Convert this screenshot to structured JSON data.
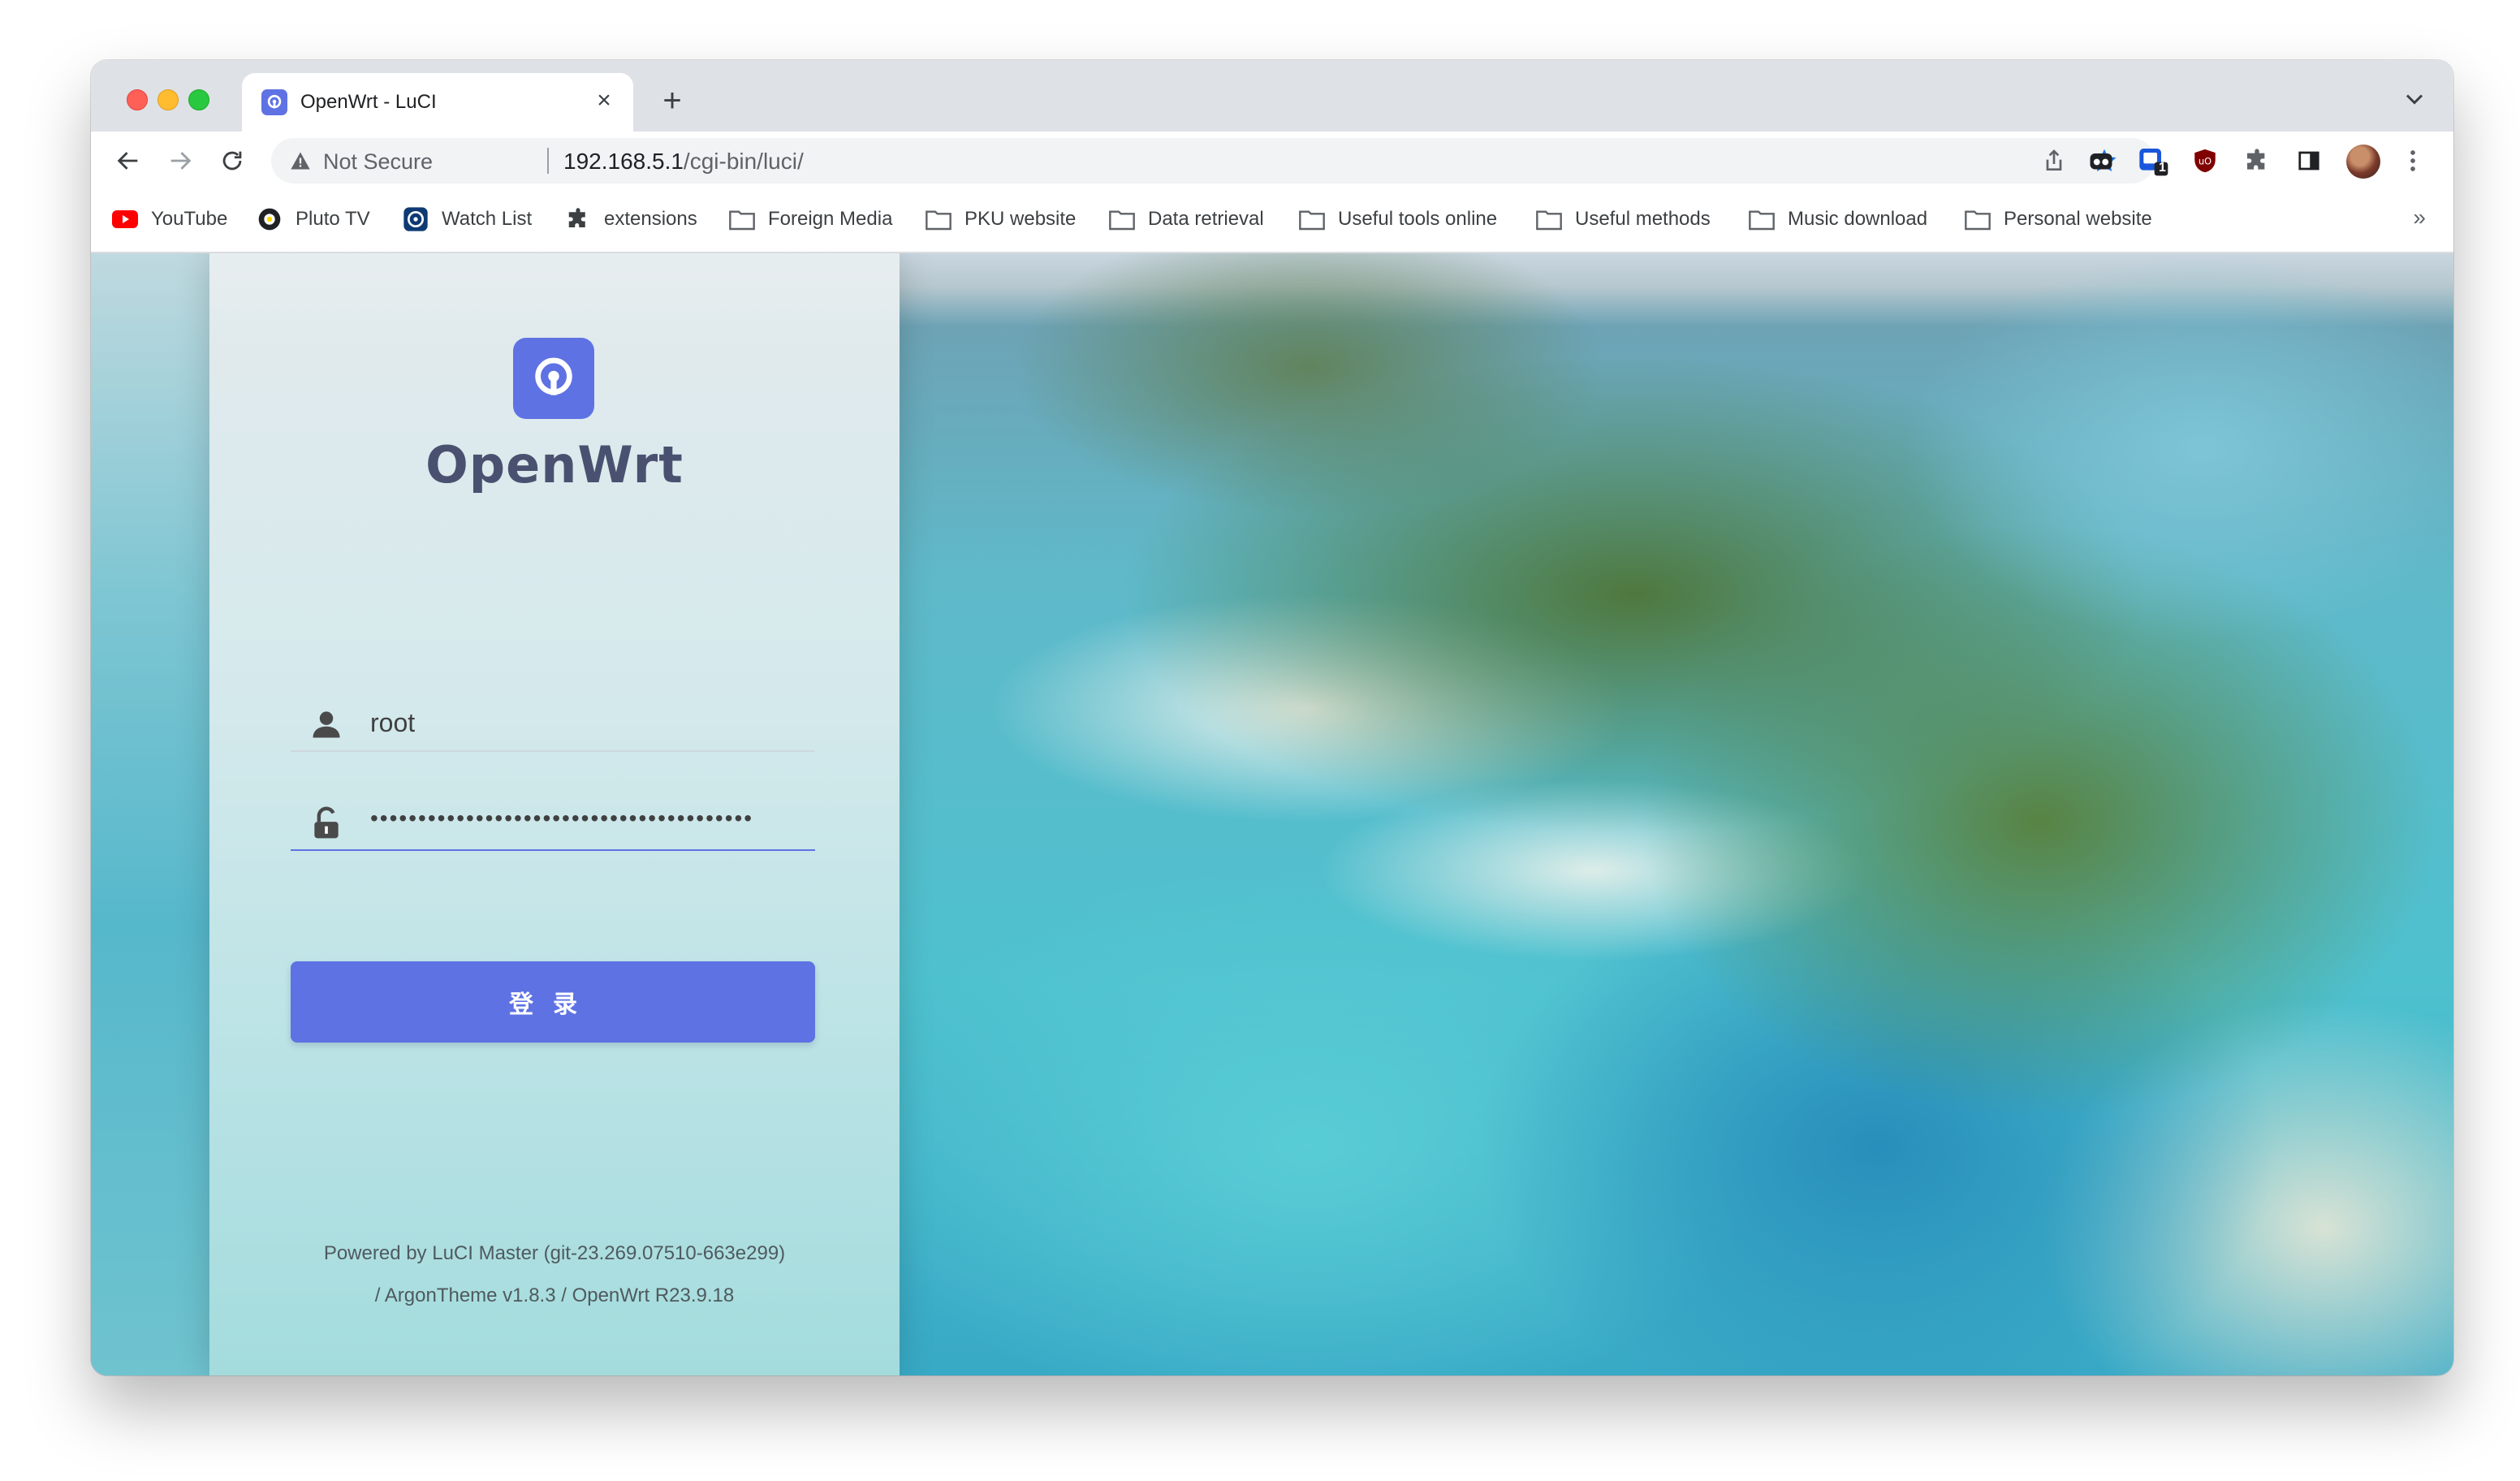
{
  "browser": {
    "tab_title": "OpenWrt - LuCI",
    "tab_close": "×",
    "new_tab": "+",
    "security_label": "Not Secure",
    "url_host": "192.168.5.1",
    "url_path": "/cgi-bin/luci/",
    "extension_badge": "1",
    "bookmarks": [
      {
        "label": "YouTube",
        "icon": "youtube-icon"
      },
      {
        "label": "Pluto TV",
        "icon": "pluto-tv-icon"
      },
      {
        "label": "Watch List",
        "icon": "watch-list-icon"
      },
      {
        "label": "extensions",
        "icon": "puzzle-icon"
      },
      {
        "label": "Foreign Media",
        "icon": "folder-icon"
      },
      {
        "label": "PKU website",
        "icon": "folder-icon"
      },
      {
        "label": "Data retrieval",
        "icon": "folder-icon"
      },
      {
        "label": "Useful tools online",
        "icon": "folder-icon"
      },
      {
        "label": "Useful methods",
        "icon": "folder-icon"
      },
      {
        "label": "Music download",
        "icon": "folder-icon"
      },
      {
        "label": "Personal website",
        "icon": "folder-icon"
      }
    ],
    "bookmarks_overflow": "»"
  },
  "login": {
    "brand": "OpenWrt",
    "username": "root",
    "password_mask": "••••••••••••••••••••••••••••••••••••••••",
    "button_label": "登录",
    "footer_line1": "Powered by LuCI Master (git-23.269.07510-663e299)",
    "footer_line2": "/ ArgonTheme v1.8.3 / OpenWrt R23.9.18"
  },
  "colors": {
    "accent": "#5e72e4",
    "star": "#1a73e8"
  }
}
